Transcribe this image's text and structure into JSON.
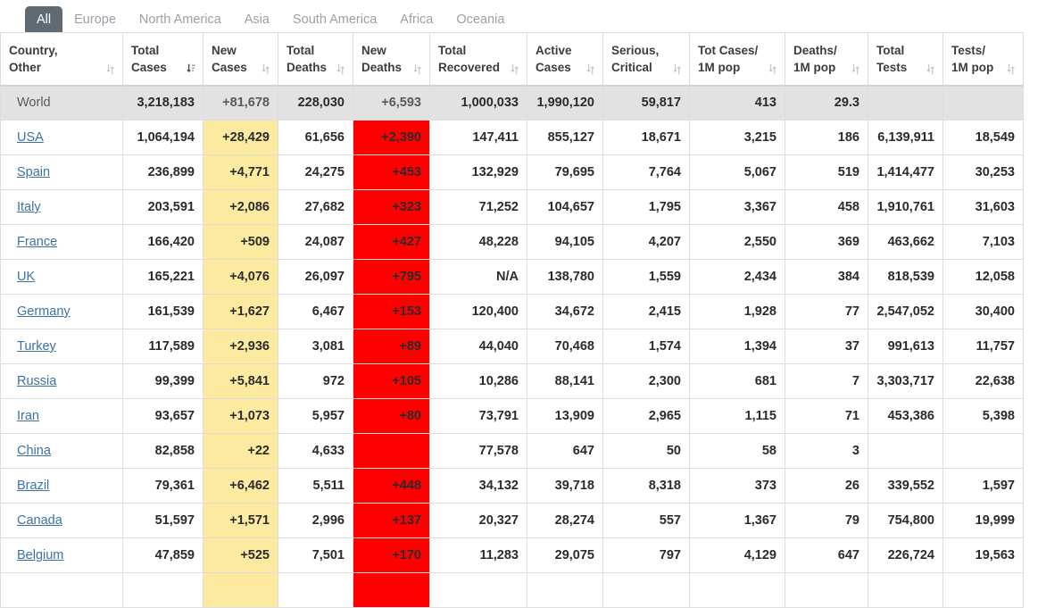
{
  "tabs": [
    {
      "label": "All",
      "active": true
    },
    {
      "label": "Europe",
      "active": false
    },
    {
      "label": "North America",
      "active": false
    },
    {
      "label": "Asia",
      "active": false
    },
    {
      "label": "South America",
      "active": false
    },
    {
      "label": "Africa",
      "active": false
    },
    {
      "label": "Oceania",
      "active": false
    }
  ],
  "colors": {
    "active_tab_bg": "#5f6a72",
    "new_cases_highlight": "#fdeaa1",
    "new_deaths_highlight": "#ff0000",
    "world_row_bg": "#e2e2e2",
    "country_link": "#3c72a8"
  },
  "table": {
    "columns": [
      {
        "line1": "Country,",
        "line2": "Other",
        "sort": "both"
      },
      {
        "line1": "Total",
        "line2": "Cases",
        "sort": "desc-active"
      },
      {
        "line1": "New",
        "line2": "Cases",
        "sort": "both"
      },
      {
        "line1": "Total",
        "line2": "Deaths",
        "sort": "both"
      },
      {
        "line1": "New",
        "line2": "Deaths",
        "sort": "both"
      },
      {
        "line1": "Total",
        "line2": "Recovered",
        "sort": "both"
      },
      {
        "line1": "Active",
        "line2": "Cases",
        "sort": "both"
      },
      {
        "line1": "Serious,",
        "line2": "Critical",
        "sort": "both"
      },
      {
        "line1": "Tot Cases/",
        "line2": "1M pop",
        "sort": "both"
      },
      {
        "line1": "Deaths/",
        "line2": "1M pop",
        "sort": "both"
      },
      {
        "line1": "Total",
        "line2": "Tests",
        "sort": "both"
      },
      {
        "line1": "Tests/",
        "line2": "1M pop",
        "sort": "both"
      }
    ],
    "world": {
      "name": "World",
      "total_cases": "3,218,183",
      "new_cases": "+81,678",
      "total_deaths": "228,030",
      "new_deaths": "+6,593",
      "total_recovered": "1,000,033",
      "active_cases": "1,990,120",
      "serious_critical": "59,817",
      "tot_cases_1m": "413",
      "deaths_1m": "29.3",
      "total_tests": "",
      "tests_1m": ""
    },
    "rows": [
      {
        "name": "USA",
        "total_cases": "1,064,194",
        "new_cases": "+28,429",
        "total_deaths": "61,656",
        "new_deaths": "+2,390",
        "total_recovered": "147,411",
        "active_cases": "855,127",
        "serious_critical": "18,671",
        "tot_cases_1m": "3,215",
        "deaths_1m": "186",
        "total_tests": "6,139,911",
        "tests_1m": "18,549"
      },
      {
        "name": "Spain",
        "total_cases": "236,899",
        "new_cases": "+4,771",
        "total_deaths": "24,275",
        "new_deaths": "+453",
        "total_recovered": "132,929",
        "active_cases": "79,695",
        "serious_critical": "7,764",
        "tot_cases_1m": "5,067",
        "deaths_1m": "519",
        "total_tests": "1,414,477",
        "tests_1m": "30,253"
      },
      {
        "name": "Italy",
        "total_cases": "203,591",
        "new_cases": "+2,086",
        "total_deaths": "27,682",
        "new_deaths": "+323",
        "total_recovered": "71,252",
        "active_cases": "104,657",
        "serious_critical": "1,795",
        "tot_cases_1m": "3,367",
        "deaths_1m": "458",
        "total_tests": "1,910,761",
        "tests_1m": "31,603"
      },
      {
        "name": "France",
        "total_cases": "166,420",
        "new_cases": "+509",
        "total_deaths": "24,087",
        "new_deaths": "+427",
        "total_recovered": "48,228",
        "active_cases": "94,105",
        "serious_critical": "4,207",
        "tot_cases_1m": "2,550",
        "deaths_1m": "369",
        "total_tests": "463,662",
        "tests_1m": "7,103"
      },
      {
        "name": "UK",
        "total_cases": "165,221",
        "new_cases": "+4,076",
        "total_deaths": "26,097",
        "new_deaths": "+795",
        "total_recovered": "N/A",
        "active_cases": "138,780",
        "serious_critical": "1,559",
        "tot_cases_1m": "2,434",
        "deaths_1m": "384",
        "total_tests": "818,539",
        "tests_1m": "12,058"
      },
      {
        "name": "Germany",
        "total_cases": "161,539",
        "new_cases": "+1,627",
        "total_deaths": "6,467",
        "new_deaths": "+153",
        "total_recovered": "120,400",
        "active_cases": "34,672",
        "serious_critical": "2,415",
        "tot_cases_1m": "1,928",
        "deaths_1m": "77",
        "total_tests": "2,547,052",
        "tests_1m": "30,400"
      },
      {
        "name": "Turkey",
        "total_cases": "117,589",
        "new_cases": "+2,936",
        "total_deaths": "3,081",
        "new_deaths": "+89",
        "total_recovered": "44,040",
        "active_cases": "70,468",
        "serious_critical": "1,574",
        "tot_cases_1m": "1,394",
        "deaths_1m": "37",
        "total_tests": "991,613",
        "tests_1m": "11,757"
      },
      {
        "name": "Russia",
        "total_cases": "99,399",
        "new_cases": "+5,841",
        "total_deaths": "972",
        "new_deaths": "+105",
        "total_recovered": "10,286",
        "active_cases": "88,141",
        "serious_critical": "2,300",
        "tot_cases_1m": "681",
        "deaths_1m": "7",
        "total_tests": "3,303,717",
        "tests_1m": "22,638"
      },
      {
        "name": "Iran",
        "total_cases": "93,657",
        "new_cases": "+1,073",
        "total_deaths": "5,957",
        "new_deaths": "+80",
        "total_recovered": "73,791",
        "active_cases": "13,909",
        "serious_critical": "2,965",
        "tot_cases_1m": "1,115",
        "deaths_1m": "71",
        "total_tests": "453,386",
        "tests_1m": "5,398"
      },
      {
        "name": "China",
        "total_cases": "82,858",
        "new_cases": "+22",
        "total_deaths": "4,633",
        "new_deaths": "",
        "total_recovered": "77,578",
        "active_cases": "647",
        "serious_critical": "50",
        "tot_cases_1m": "58",
        "deaths_1m": "3",
        "total_tests": "",
        "tests_1m": ""
      },
      {
        "name": "Brazil",
        "total_cases": "79,361",
        "new_cases": "+6,462",
        "total_deaths": "5,511",
        "new_deaths": "+448",
        "total_recovered": "34,132",
        "active_cases": "39,718",
        "serious_critical": "8,318",
        "tot_cases_1m": "373",
        "deaths_1m": "26",
        "total_tests": "339,552",
        "tests_1m": "1,597"
      },
      {
        "name": "Canada",
        "total_cases": "51,597",
        "new_cases": "+1,571",
        "total_deaths": "2,996",
        "new_deaths": "+137",
        "total_recovered": "20,327",
        "active_cases": "28,274",
        "serious_critical": "557",
        "tot_cases_1m": "1,367",
        "deaths_1m": "79",
        "total_tests": "754,800",
        "tests_1m": "19,999"
      },
      {
        "name": "Belgium",
        "total_cases": "47,859",
        "new_cases": "+525",
        "total_deaths": "7,501",
        "new_deaths": "+170",
        "total_recovered": "11,283",
        "active_cases": "29,075",
        "serious_critical": "797",
        "tot_cases_1m": "4,129",
        "deaths_1m": "647",
        "total_tests": "226,724",
        "tests_1m": "19,563"
      },
      {
        "name": "",
        "total_cases": "",
        "new_cases": "",
        "total_deaths": "",
        "new_deaths": "",
        "total_recovered": "",
        "active_cases": "",
        "serious_critical": "",
        "tot_cases_1m": "",
        "deaths_1m": "",
        "total_tests": "",
        "tests_1m": ""
      }
    ]
  }
}
